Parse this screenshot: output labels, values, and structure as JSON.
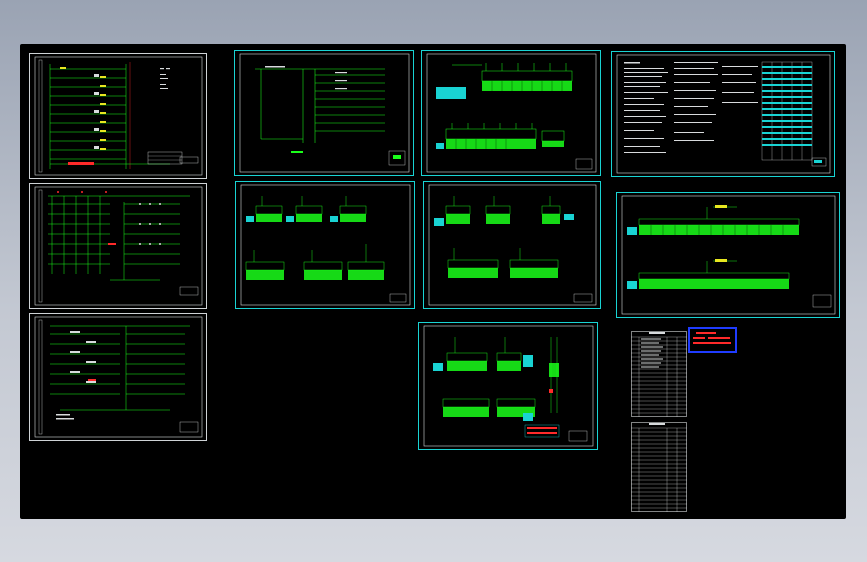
{
  "app": {
    "window_title": "",
    "background_gradient_top": "#9aa3b3",
    "background_gradient_bottom": "#d6d9e0"
  },
  "model_space": {
    "background": "#000000"
  },
  "colors": {
    "wire_green": "#1aff1a",
    "frame_white": "#d8dbdd",
    "cyan": "#19d3d3",
    "red": "#ff2a2a",
    "blue": "#1f3cff",
    "yellow": "#e8e820"
  },
  "sheets": [
    {
      "id": "sheet-riser-1",
      "kind": "riser-diagram"
    },
    {
      "id": "sheet-riser-2",
      "kind": "riser-diagram"
    },
    {
      "id": "sheet-riser-3",
      "kind": "riser-diagram"
    },
    {
      "id": "sheet-system-1",
      "kind": "system-diagram"
    },
    {
      "id": "sheet-panels-1",
      "kind": "panel-schedule"
    },
    {
      "id": "sheet-panels-2",
      "kind": "panel-schedule"
    },
    {
      "id": "sheet-panels-3",
      "kind": "panel-schedule"
    },
    {
      "id": "sheet-panels-4",
      "kind": "panel-schedule"
    },
    {
      "id": "sheet-notes",
      "kind": "design-notes"
    },
    {
      "id": "sheet-panels-wide",
      "kind": "panel-schedule"
    }
  ],
  "stamp": {
    "lines": [
      "",
      "",
      ""
    ]
  },
  "drawing_lists": [
    {
      "id": "list-1",
      "rows": 22
    },
    {
      "id": "list-2",
      "rows": 20
    }
  ]
}
